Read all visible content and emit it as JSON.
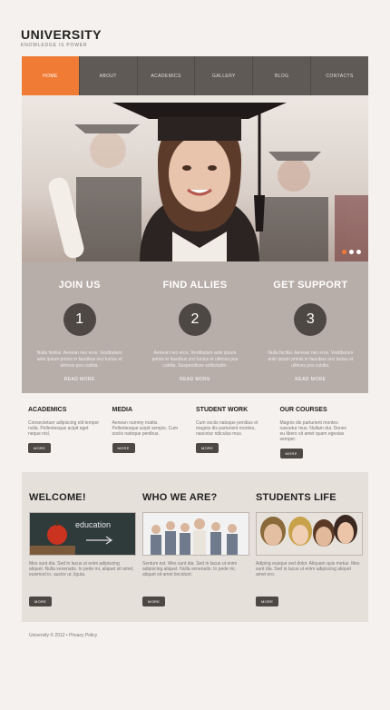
{
  "site": {
    "title": "UNIVERSITY",
    "tagline": "KNOWLEDGE IS POWER"
  },
  "nav": [
    {
      "label": "HOME",
      "active": true
    },
    {
      "label": "ABOUT",
      "active": false
    },
    {
      "label": "ACADEMICS",
      "active": false
    },
    {
      "label": "GALLERY",
      "active": false
    },
    {
      "label": "BLOG",
      "active": false
    },
    {
      "label": "CONTACTS",
      "active": false
    }
  ],
  "colors": {
    "accent": "#f07b35",
    "nav_bg": "#5f5a56",
    "steps_bg": "#b8aea9",
    "dark": "#4e4844"
  },
  "steps": [
    {
      "title": "JOIN US",
      "number": "1",
      "text": "Nulla facilisi. Aenean nec eros. Vestibulum ante ipsum primis in faucibus orci luctus et ultrices pos cubilia.",
      "link": "READ MORE"
    },
    {
      "title": "FIND ALLIES",
      "number": "2",
      "text": "Aenean nec eros. Vestibulum ante ipsum primis in faucibus orci luctus et ultrices pos cubilia. Suspendisse sollicitudin.",
      "link": "READ MORE"
    },
    {
      "title": "GET SUPPORT",
      "number": "3",
      "text": "Nulla facilisi. Aenean nec eros. Vestibulum ante ipsum primis in faucibus orci luctus et ultrices pos cubilia.",
      "link": "READ MORE"
    }
  ],
  "columns": [
    {
      "title": "ACADEMICS",
      "text": "Consectetuer adipiscing elit tempor nulla. Pellentesque acipit eget neque nisl.",
      "button": "MORE"
    },
    {
      "title": "MEDIA",
      "text": "Aenean nummy mattis. Pellentesque acipit sempis. Cum sociis natoque penibus.",
      "button": "MORE"
    },
    {
      "title": "STUDENT WORK",
      "text": "Cum sociis natoque penibus et magnis dis parturient montes, nascetur ridiculus mus.",
      "button": "MORE"
    },
    {
      "title": "OUR COURSES",
      "text": "Magnis dis parturient montes nascetur mus. Nullam dui. Donec eu libero sit amet quam egestas semper.",
      "button": "MORE"
    }
  ],
  "panels": [
    {
      "title": "WELCOME!",
      "image": "education-apple-chalkboard",
      "image_text": "education",
      "text": "Mes sunt dia. Sed in lacus ut enim adipiscing aliquet. Nulla venenatis. In pede mi, aliquet sit amet, euismod in, auctor ut, ligula.",
      "button": "MORE"
    },
    {
      "title": "WHO WE ARE?",
      "image": "group-of-students",
      "text": "Sentum est. Mes sunt dia. Sed in lacus ut enim adipiscing aliquet. Nulla venenatis. In pede mi, aliquet sit amet tincidunt.",
      "button": "MORE"
    },
    {
      "title": "STUDENTS LIFE",
      "image": "smiling-students",
      "text": "Adiping eusque sed dolor. Aliquam quis metus. Mes sunt dia. Sed in lacus ut enim adipiscing aliquet amet ero.",
      "button": "MORE"
    }
  ],
  "slider": {
    "total": 3,
    "active": 0
  },
  "footer": {
    "text": "University © 2012 • Privacy Policy"
  }
}
